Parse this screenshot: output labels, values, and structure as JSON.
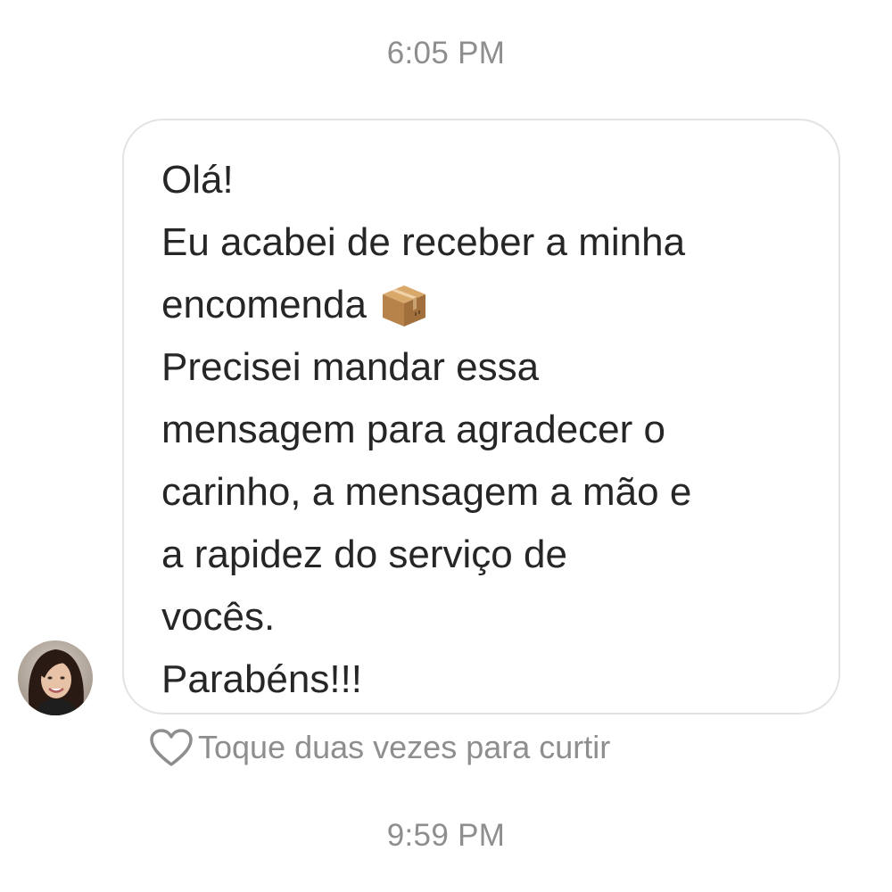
{
  "chat": {
    "timestamp_top": "6:05 PM",
    "timestamp_bottom": "9:59 PM",
    "message": {
      "lines": [
        "Olá!",
        "Eu acabei de receber a minha",
        "encomenda",
        "Precisei mandar essa",
        "mensagem para agradecer o",
        "carinho, a mensagem a mão e",
        "a rapidez do serviço de",
        "vocês.",
        "Parabéns!!!"
      ],
      "emoji": "package-icon"
    },
    "like_hint": "Toque duas vezes para curtir",
    "icons": {
      "heart": "heart-outline-icon",
      "avatar": "sender-avatar"
    },
    "colors": {
      "timestamp": "#8e8e8e",
      "message_text": "#262626",
      "bubble_border": "#e3e3e3",
      "background": "#ffffff"
    }
  }
}
